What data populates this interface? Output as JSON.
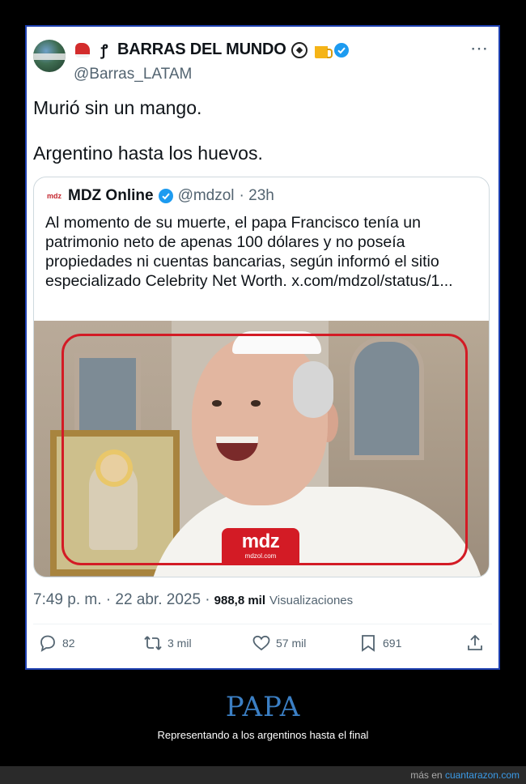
{
  "tweet": {
    "display_name": "BARRAS DEL MUNDO",
    "handle": "@Barras_LATAM",
    "more_icon": "⋯",
    "text": "Murió sin un mango.\n\nArgentino hasta los huevos.",
    "timestamp": "7:49 p. m. · 22 abr. 2025 ·",
    "views_count": "988,8 mil",
    "views_label": "Visualizaciones",
    "verified_color": "#1d9bf0",
    "icons": [
      "boxing-glove-icon",
      "sailor-tattoo-icon",
      "soccer-ball-icon",
      "beer-icon",
      "verified-badge-icon"
    ]
  },
  "quote": {
    "logo_text": "mdz",
    "name": "MDZ Online",
    "handle": "@mdzol",
    "age": "· 23h",
    "text": "Al momento de su muerte, el papa Francisco tenía un patrimonio neto de apenas 100 dólares y no poseía propiedades ni cuentas bancarias, según informó el sitio especializado Celebrity Net Worth. x.com/mdzol/status/1...",
    "image_badge_main": "mdz",
    "image_badge_sub": "mdzol.com",
    "highlight_color": "#d31b25"
  },
  "actions": {
    "replies": "82",
    "retweets": "3 mil",
    "likes": "57 mil",
    "bookmarks": "691"
  },
  "footer": {
    "title": "PAPA",
    "subtitle": "Representando a los argentinos hasta el final",
    "more_prefix": "más en",
    "site": "cuantarazon.com",
    "title_color": "#3b7fc4"
  }
}
